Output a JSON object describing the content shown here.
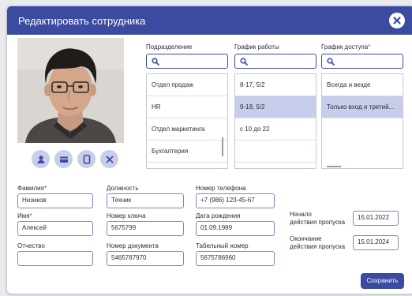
{
  "dialog": {
    "title": "Редактировать сотрудника",
    "close_icon": "close-icon",
    "save_label": "Сохранить"
  },
  "photo_actions": [
    {
      "name": "user-icon"
    },
    {
      "name": "card-icon"
    },
    {
      "name": "device-icon"
    },
    {
      "name": "remove-icon"
    }
  ],
  "columns": {
    "department": {
      "label": "Подразделение",
      "search_value": "",
      "items": [
        "Отдел продаж",
        "HR",
        "Отдел маркетинга",
        "Бухгалтерия"
      ],
      "selected_index": -1
    },
    "schedule": {
      "label": "График работы",
      "search_value": "",
      "items": [
        "8-17, 5/2",
        "9-18, 5/2",
        "с 10 до 22",
        ""
      ],
      "selected_index": 1
    },
    "access": {
      "label": "График доступа",
      "required_mark": "*",
      "search_value": "",
      "items": [
        "Всегда и везде",
        "Только вход и третий..."
      ],
      "selected_index": 1
    }
  },
  "form": {
    "last_name": {
      "label": "Фамилия",
      "required_mark": "*",
      "value": "Низиков"
    },
    "first_name": {
      "label": "Имя",
      "required_mark": "*",
      "value": "Алексей"
    },
    "patronymic": {
      "label": "Отчество",
      "value": ""
    },
    "position": {
      "label": "Должность",
      "value": "Техник"
    },
    "key_number": {
      "label": "Номер ключа",
      "value": "5675799"
    },
    "document_number": {
      "label": "Номер документа",
      "value": "5465787970"
    },
    "phone": {
      "label": "Номер телефона",
      "value": "+7 (986) 123-45-67"
    },
    "birth_date": {
      "label": "Дата рождения",
      "value": "01.09.1989"
    },
    "personnel_number": {
      "label": "Табельный номер",
      "value": "5675786960"
    }
  },
  "pass": {
    "start_label_line1": "Начало",
    "start_label_line2": "действия пропуска",
    "start_value": "15.01.2022",
    "end_label_line1": "Окончание",
    "end_label_line2": "действия пропуска",
    "end_value": "15.01.2024"
  },
  "colors": {
    "accent": "#3b4ba0",
    "selection": "#c7cdea",
    "required": "#d33030"
  }
}
